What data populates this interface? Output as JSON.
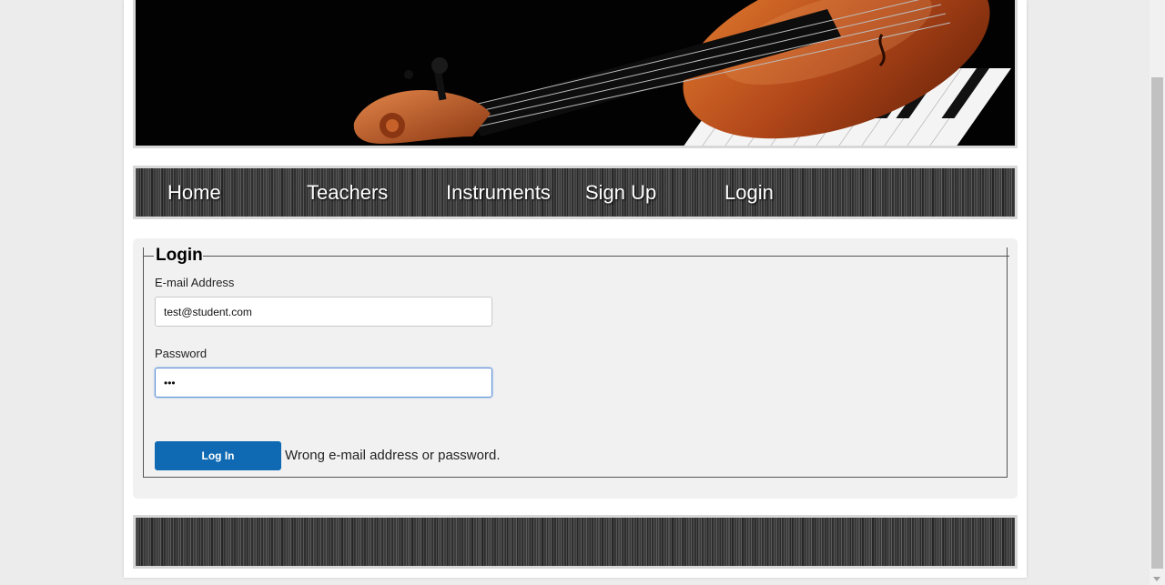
{
  "nav": {
    "items": [
      {
        "label": "Home"
      },
      {
        "label": "Teachers"
      },
      {
        "label": "Instruments"
      },
      {
        "label": "Sign Up"
      },
      {
        "label": "Login"
      }
    ]
  },
  "login": {
    "legend": "Login",
    "email_label": "E-mail Address",
    "email_value": "test@student.com",
    "password_label": "Password",
    "password_value": "•••",
    "submit_label": "Log In",
    "error_message": "Wrong e-mail address or password."
  },
  "colors": {
    "button": "#0f6ab3",
    "nav_text": "#ffffff",
    "focus_border": "#5b8fd6"
  },
  "icons": {
    "banner": "violin-on-piano-image",
    "scroll_down": "chevron-down-icon"
  }
}
